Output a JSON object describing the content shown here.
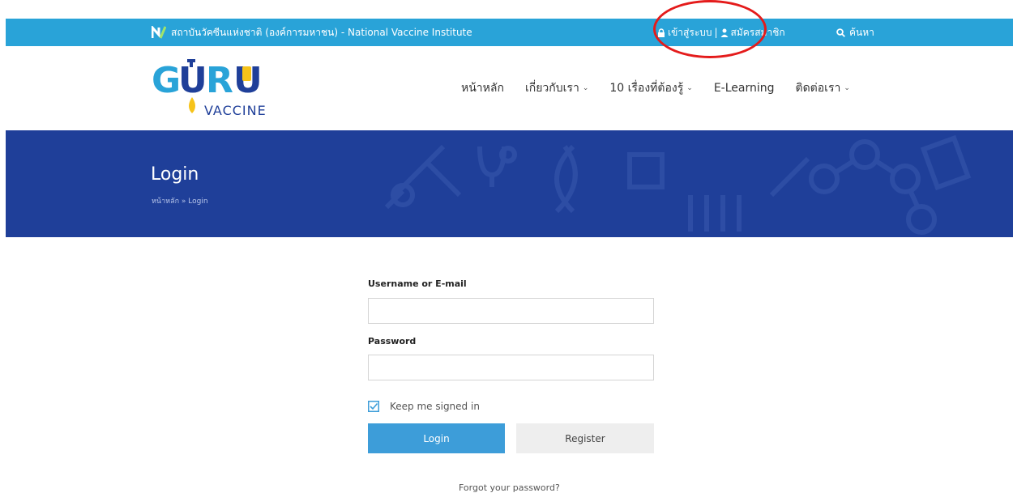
{
  "topbar": {
    "institute": "สถาบันวัคซีนแห่งชาติ (องค์การมหาชน) - National Vaccine Institute",
    "login_link": "เข้าสู่ระบบ",
    "separator": "|",
    "register_link": "สมัครสมาชิก",
    "search_link": "ค้นหา",
    "bg_color": "#29a3d8"
  },
  "logo": {
    "word": "GURU",
    "subword": "VACCINE"
  },
  "nav": {
    "items": [
      {
        "label": "หน้าหลัก",
        "has_dropdown": false
      },
      {
        "label": "เกี่ยวกับเรา",
        "has_dropdown": true
      },
      {
        "label": "10 เรื่องที่ต้องรู้",
        "has_dropdown": true
      },
      {
        "label": "E-Learning",
        "has_dropdown": false
      },
      {
        "label": "ติดต่อเรา",
        "has_dropdown": true
      }
    ],
    "chevron": "⌄"
  },
  "hero": {
    "title": "Login",
    "breadcrumb": "หน้าหลัก » Login",
    "bg_color": "#1f3f99"
  },
  "form": {
    "username_label": "Username or E-mail",
    "username_value": "",
    "password_label": "Password",
    "password_value": "",
    "remember_label": "Keep me signed in",
    "remember_checked": true,
    "login_button": "Login",
    "register_button": "Register",
    "forgot_link": "Forgot your password?",
    "accent_color": "#3d9dd9"
  },
  "annotation": {
    "highlight_color": "#e41b1b"
  }
}
